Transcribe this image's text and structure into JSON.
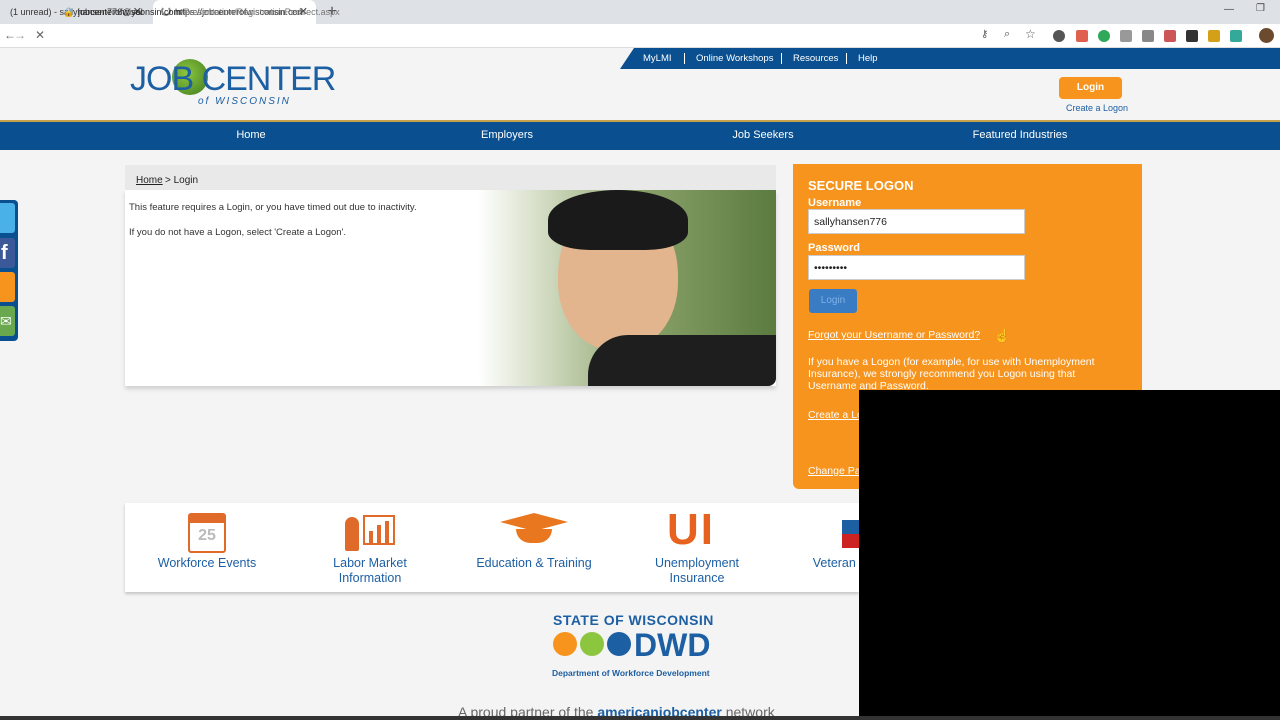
{
  "browser": {
    "tabs": [
      {
        "label": "(1 unread) - sallyhansen776@yal",
        "active": false
      },
      {
        "label": "https://jobcenterofwisconsin.com",
        "active": true
      }
    ],
    "url_host": "jobcenterofwisconsin.com",
    "url_path": "/Presentation/RegistrationRedirect.aspx"
  },
  "util_nav": [
    "MyLMI",
    "Online Workshops",
    "Resources",
    "Help"
  ],
  "logo": {
    "main": "JOB CENTER",
    "sub": "of WISCONSIN"
  },
  "header": {
    "login_label": "Login",
    "create_logon": "Create a Logon"
  },
  "main_nav": [
    "Home",
    "Employers",
    "Job Seekers",
    "Featured Industries"
  ],
  "breadcrumb": {
    "home": "Home",
    "rest": "> Login"
  },
  "message": {
    "line1": "This feature requires a Login, or you have timed out due to inactivity.",
    "line2": "If you do not have a Logon, select 'Create a Logon'."
  },
  "secure_logon": {
    "title": "SECURE LOGON",
    "username_label": "Username",
    "username_value": "sallyhansen776",
    "password_label": "Password",
    "password_value": "•••••••••",
    "button": "Login",
    "forgot": "Forgot your Username or Password?",
    "info": "If you have a Logon (for example, for use with Unemployment Insurance), we strongly recommend you Logon using that Username and Password.",
    "create": "Create a Logon",
    "change": "Change Password"
  },
  "icons": [
    {
      "label": "Workforce Events",
      "icon": "calendar-icon",
      "date": "25"
    },
    {
      "label": "Labor Market Information",
      "icon": "presentation-icon"
    },
    {
      "label": "Education & Training",
      "icon": "graduation-cap-icon"
    },
    {
      "label": "Unemployment Insurance",
      "icon": "ui-icon",
      "glyph": "UI"
    },
    {
      "label": "Veteran Services",
      "icon": "flag-icon"
    }
  ],
  "footer": {
    "state": "STATE OF WISCONSIN",
    "dwd": "DWD",
    "dept": "Department of Workforce Development",
    "partner_pre": "A proud partner of the ",
    "partner_brand": "americanjobcenter",
    "partner_post": " network"
  },
  "colors": {
    "navy": "#0a4f8f",
    "orange": "#f7941d",
    "link": "#1d5fa3"
  }
}
